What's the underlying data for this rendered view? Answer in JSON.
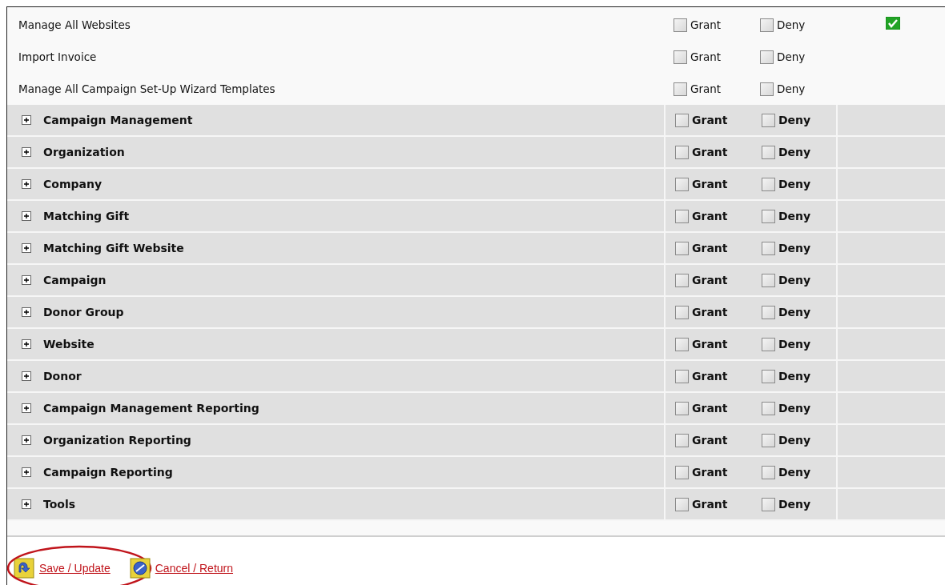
{
  "permissions": [
    {
      "kind": "plain",
      "label": "Manage All Websites",
      "grant": {
        "label": "Grant",
        "checked": false
      },
      "deny": {
        "label": "Deny",
        "checked": false
      },
      "effective": true
    },
    {
      "kind": "plain",
      "label": "Import Invoice",
      "grant": {
        "label": "Grant",
        "checked": false
      },
      "deny": {
        "label": "Deny",
        "checked": false
      },
      "effective": false
    },
    {
      "kind": "plain",
      "label": "Manage All Campaign Set-Up Wizard Templates",
      "grant": {
        "label": "Grant",
        "checked": false
      },
      "deny": {
        "label": "Deny",
        "checked": false
      },
      "effective": false
    },
    {
      "kind": "group",
      "label": "Campaign Management",
      "expanded": false,
      "grant": {
        "label": "Grant",
        "checked": false
      },
      "deny": {
        "label": "Deny",
        "checked": false
      }
    },
    {
      "kind": "group",
      "label": "Organization",
      "expanded": false,
      "grant": {
        "label": "Grant",
        "checked": false
      },
      "deny": {
        "label": "Deny",
        "checked": false
      }
    },
    {
      "kind": "group",
      "label": "Company",
      "expanded": false,
      "grant": {
        "label": "Grant",
        "checked": false
      },
      "deny": {
        "label": "Deny",
        "checked": false
      }
    },
    {
      "kind": "group",
      "label": "Matching Gift",
      "expanded": false,
      "grant": {
        "label": "Grant",
        "checked": false
      },
      "deny": {
        "label": "Deny",
        "checked": false
      }
    },
    {
      "kind": "group",
      "label": "Matching Gift Website",
      "expanded": false,
      "grant": {
        "label": "Grant",
        "checked": false
      },
      "deny": {
        "label": "Deny",
        "checked": false
      }
    },
    {
      "kind": "group",
      "label": "Campaign",
      "expanded": false,
      "grant": {
        "label": "Grant",
        "checked": false
      },
      "deny": {
        "label": "Deny",
        "checked": false
      }
    },
    {
      "kind": "group",
      "label": "Donor Group",
      "expanded": false,
      "grant": {
        "label": "Grant",
        "checked": false
      },
      "deny": {
        "label": "Deny",
        "checked": false
      }
    },
    {
      "kind": "group",
      "label": "Website",
      "expanded": false,
      "grant": {
        "label": "Grant",
        "checked": false
      },
      "deny": {
        "label": "Deny",
        "checked": false
      }
    },
    {
      "kind": "group",
      "label": "Donor",
      "expanded": false,
      "grant": {
        "label": "Grant",
        "checked": false
      },
      "deny": {
        "label": "Deny",
        "checked": false
      }
    },
    {
      "kind": "group",
      "label": "Campaign Management Reporting",
      "expanded": false,
      "grant": {
        "label": "Grant",
        "checked": false
      },
      "deny": {
        "label": "Deny",
        "checked": false
      }
    },
    {
      "kind": "group",
      "label": "Organization Reporting",
      "expanded": false,
      "grant": {
        "label": "Grant",
        "checked": false
      },
      "deny": {
        "label": "Deny",
        "checked": false
      }
    },
    {
      "kind": "group",
      "label": "Campaign Reporting",
      "expanded": false,
      "grant": {
        "label": "Grant",
        "checked": false
      },
      "deny": {
        "label": "Deny",
        "checked": false
      }
    },
    {
      "kind": "group",
      "label": "Tools",
      "expanded": false,
      "grant": {
        "label": "Grant",
        "checked": false
      },
      "deny": {
        "label": "Deny",
        "checked": false
      }
    }
  ],
  "actions": [
    {
      "kind": "save",
      "label": "Save / Update",
      "highlighted": true
    },
    {
      "kind": "cancel",
      "label": "Cancel / Return",
      "highlighted": false
    }
  ]
}
